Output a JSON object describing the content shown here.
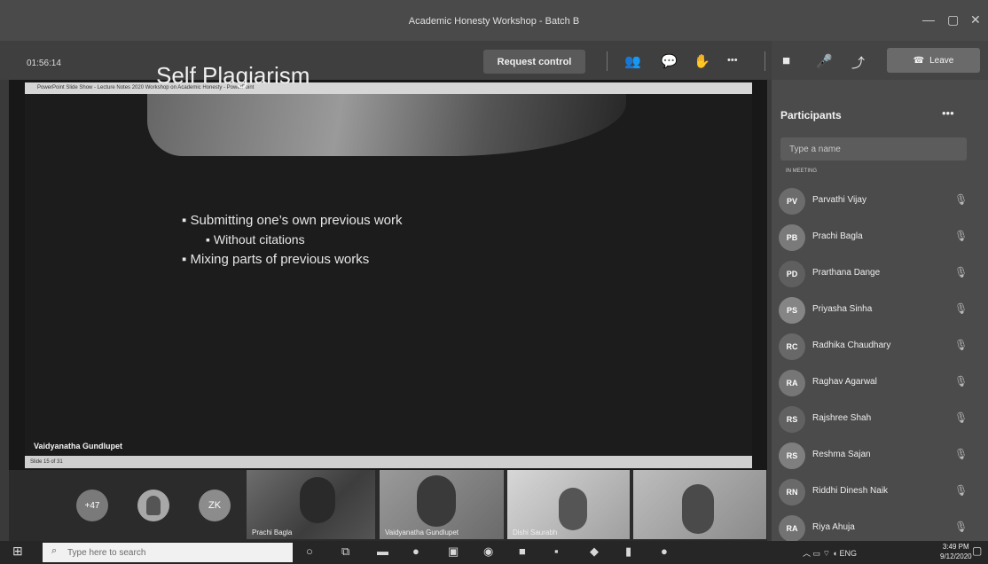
{
  "window": {
    "title": "Academic Honesty Workshop - Batch B",
    "minimize": "—",
    "maximize": "▢",
    "close": "✕"
  },
  "toolbar": {
    "timer": "01:56:14",
    "request_control": "Request control",
    "leave": "Leave",
    "icons": {
      "participants": "👥",
      "chat": "💬",
      "raise_hand": "✋",
      "more": "•••",
      "camera": "■",
      "mic": "🎤",
      "share": "⤴",
      "phone": "☎"
    }
  },
  "presentation": {
    "app_bar": "PowerPoint Slide Show - Lecture Notes 2020 Workshop on Academic Honesty - PowerPoint",
    "slide_title": "Self Plagiarism",
    "bullets": [
      "Submitting one’s own previous work",
      "Without citations",
      "Mixing parts of previous works"
    ],
    "slide_counter": "Slide 15 of 31",
    "presenter": "Vaidyanatha Gundlupet"
  },
  "strip": {
    "overflow_count": "+47",
    "zk_initials": "ZK",
    "tiles": [
      {
        "name": "Prachi Bagla"
      },
      {
        "name": "Vaidyanatha Gundlupet"
      },
      {
        "name": "Dishi Saurabh"
      },
      {
        "name": ""
      }
    ]
  },
  "participants": {
    "title": "Participants",
    "more": "•••",
    "search_placeholder": "Type a name",
    "section_label": "IN MEETING",
    "list": [
      {
        "initials": "PV",
        "name": "Parvathi Vijay"
      },
      {
        "initials": "PB",
        "name": "Prachi Bagla"
      },
      {
        "initials": "PD",
        "name": "Prarthana Dange"
      },
      {
        "initials": "PS",
        "name": "Priyasha Sinha"
      },
      {
        "initials": "RC",
        "name": "Radhika Chaudhary"
      },
      {
        "initials": "RA",
        "name": "Raghav Agarwal"
      },
      {
        "initials": "RS",
        "name": "Rajshree Shah"
      },
      {
        "initials": "RS",
        "name": "Reshma Sajan"
      },
      {
        "initials": "RN",
        "name": "Riddhi Dinesh Naik"
      },
      {
        "initials": "RA",
        "name": "Riya Ahuja"
      }
    ],
    "mic_glyph": "🎙"
  },
  "taskbar": {
    "start": "⊞",
    "search_placeholder": "Type here to search",
    "clock_time": "3:49 PM",
    "clock_date": "9/12/2020",
    "language": "ENG"
  },
  "colors": {
    "titlebar": "#4a4a4a",
    "panel": "#4b4b4b",
    "share_bg": "#181818",
    "leave": "#6a6a6a"
  }
}
